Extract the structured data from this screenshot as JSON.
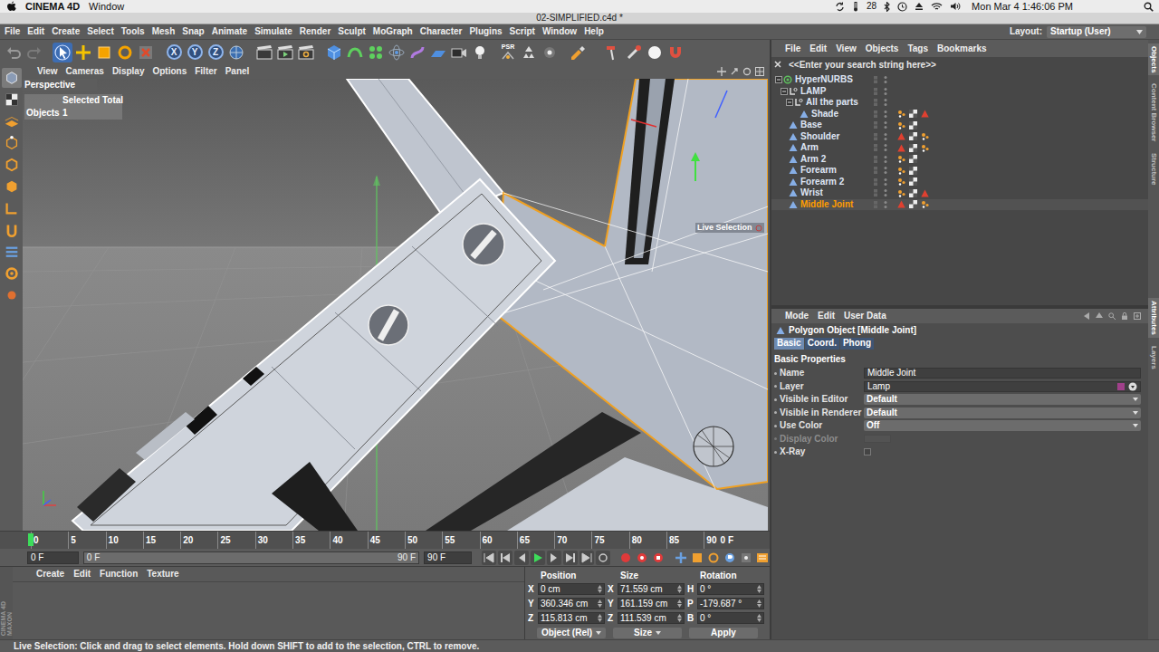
{
  "mac_menubar": {
    "app": "CINEMA 4D",
    "menus": [
      "Window"
    ],
    "indicator": "28",
    "clock": "Mon Mar 4 1:46:06 PM"
  },
  "window": {
    "title": "02-SIMPLIFIED.c4d *"
  },
  "menubar": [
    "File",
    "Edit",
    "Create",
    "Select",
    "Tools",
    "Mesh",
    "Snap",
    "Animate",
    "Simulate",
    "Render",
    "Sculpt",
    "MoGraph",
    "Character",
    "Plugins",
    "Script",
    "Window",
    "Help"
  ],
  "layout": {
    "label": "Layout:",
    "value": "Startup (User)"
  },
  "toolbar": {
    "tools": [
      {
        "selected": true
      },
      {
        "selected": false
      },
      {
        "selected": false
      },
      {
        "selected": false
      },
      {
        "selected": false
      }
    ],
    "axes": [
      {
        "label": "X",
        "on": true
      },
      {
        "label": "Y",
        "on": true
      },
      {
        "label": "Z",
        "on": true
      }
    ],
    "snap_label": "PSR"
  },
  "left_tools": [
    {
      "selected": true
    },
    {
      "selected": false
    },
    {
      "selected": false
    },
    {
      "selected": false
    },
    {
      "selected": false
    },
    {
      "selected": false
    },
    {
      "selected": false
    },
    {
      "selected": false
    },
    {
      "selected": false
    },
    {
      "selected": false
    },
    {
      "selected": false
    }
  ],
  "viewport": {
    "menus": [
      "View",
      "Cameras",
      "Display",
      "Options",
      "Filter",
      "Panel"
    ],
    "camera": "Perspective",
    "stats": {
      "header": "Selected Total",
      "label": "Objects",
      "value": "1"
    },
    "tool_label": "Live Selection"
  },
  "timeline": {
    "ticks": [
      "0",
      "5",
      "10",
      "15",
      "20",
      "25",
      "30",
      "35",
      "40",
      "45",
      "50",
      "55",
      "60",
      "65",
      "70",
      "75",
      "80",
      "85",
      "90"
    ],
    "current_frame": "0 F",
    "level": 0
  },
  "controls": {
    "start": "0 F",
    "range_start": "0 F",
    "range_end": "90 F",
    "end": "90 F"
  },
  "materials": {
    "menus": [
      "Create",
      "Edit",
      "Function",
      "Texture"
    ],
    "logo": [
      "MAXON",
      "CINEMA 4D"
    ]
  },
  "coordinates": {
    "headers": [
      "Position",
      "Size",
      "Rotation"
    ],
    "rows": [
      {
        "axis": "X",
        "position": "0 cm",
        "size_axis": "X",
        "size": "71.559 cm",
        "rotation_axis": "H",
        "rotation": "0 °"
      },
      {
        "axis": "Y",
        "position": "360.346 cm",
        "size_axis": "Y",
        "size": "161.159 cm",
        "rotation_axis": "P",
        "rotation": "-179.687 °"
      },
      {
        "axis": "Z",
        "position": "115.813 cm",
        "size_axis": "Z",
        "size": "111.539 cm",
        "rotation_axis": "B",
        "rotation": "0 °"
      }
    ],
    "mode": "Object (Rel)",
    "size_mode": "Size",
    "apply": "Apply"
  },
  "object_manager": {
    "menus": [
      "File",
      "Edit",
      "View",
      "Objects",
      "Tags",
      "Bookmarks"
    ],
    "search": {
      "placeholder": "<<Enter your search string here>>"
    },
    "objects": [
      {
        "name": "HyperNURBS",
        "kind": "hypernurbs",
        "depth": 0,
        "children": true,
        "expanded": true,
        "selected": false,
        "tags": []
      },
      {
        "name": "LAMP",
        "kind": "null",
        "depth": 1,
        "children": true,
        "expanded": true,
        "selected": false,
        "tags": []
      },
      {
        "name": "All the parts",
        "kind": "null",
        "depth": 2,
        "children": true,
        "expanded": true,
        "selected": false,
        "tags": []
      },
      {
        "name": "Shade",
        "kind": "polygon",
        "depth": 3,
        "children": false,
        "expanded": false,
        "selected": false,
        "tags": [
          {
            "kind": "phong"
          },
          {
            "kind": "material"
          },
          {
            "kind": "alert"
          }
        ]
      },
      {
        "name": "Base",
        "kind": "polygon",
        "depth": 1,
        "children": false,
        "expanded": false,
        "selected": false,
        "tags": [
          {
            "kind": "phong"
          },
          {
            "kind": "material"
          }
        ]
      },
      {
        "name": "Shoulder",
        "kind": "polygon",
        "depth": 1,
        "children": false,
        "expanded": false,
        "selected": false,
        "tags": [
          {
            "kind": "alert"
          },
          {
            "kind": "material"
          },
          {
            "kind": "phong"
          }
        ]
      },
      {
        "name": "Arm",
        "kind": "polygon",
        "depth": 1,
        "children": false,
        "expanded": false,
        "selected": false,
        "tags": [
          {
            "kind": "alert"
          },
          {
            "kind": "material"
          },
          {
            "kind": "phong"
          }
        ]
      },
      {
        "name": "Arm 2",
        "kind": "polygon",
        "depth": 1,
        "children": false,
        "expanded": false,
        "selected": false,
        "tags": [
          {
            "kind": "phong"
          },
          {
            "kind": "material"
          }
        ]
      },
      {
        "name": "Forearm",
        "kind": "polygon",
        "depth": 1,
        "children": false,
        "expanded": false,
        "selected": false,
        "tags": [
          {
            "kind": "phong"
          },
          {
            "kind": "material"
          }
        ]
      },
      {
        "name": "Forearm 2",
        "kind": "polygon",
        "depth": 1,
        "children": false,
        "expanded": false,
        "selected": false,
        "tags": [
          {
            "kind": "phong"
          },
          {
            "kind": "material"
          }
        ]
      },
      {
        "name": "Wrist",
        "kind": "polygon",
        "depth": 1,
        "children": false,
        "expanded": false,
        "selected": false,
        "tags": [
          {
            "kind": "phong"
          },
          {
            "kind": "material"
          },
          {
            "kind": "alert"
          }
        ]
      },
      {
        "name": "Middle Joint",
        "kind": "polygon",
        "depth": 1,
        "children": false,
        "expanded": false,
        "selected": true,
        "tags": [
          {
            "kind": "alert"
          },
          {
            "kind": "material"
          },
          {
            "kind": "phong"
          }
        ]
      }
    ]
  },
  "attributes": {
    "menus": [
      "Mode",
      "Edit",
      "User Data"
    ],
    "title": "Polygon Object [Middle Joint]",
    "tabs": [
      {
        "label": "Basic",
        "selected": true
      },
      {
        "label": "Coord.",
        "selected": false
      },
      {
        "label": "Phong",
        "selected": false
      }
    ],
    "section": "Basic Properties",
    "properties": [
      {
        "label": "Name",
        "kind": "text",
        "value": "Middle Joint",
        "disabled": false
      },
      {
        "label": "Layer",
        "kind": "layer",
        "value": "Lamp",
        "disabled": false
      },
      {
        "label": "Visible in Editor",
        "kind": "dropdown",
        "value": "Default",
        "disabled": false
      },
      {
        "label": "Visible in Renderer",
        "kind": "dropdown",
        "value": "Default",
        "disabled": false
      },
      {
        "label": "Use Color",
        "kind": "dropdown",
        "value": "Off",
        "disabled": false
      },
      {
        "label": "Display Color",
        "kind": "color",
        "disabled": true
      },
      {
        "label": "X-Ray",
        "kind": "checkbox",
        "checked": false,
        "disabled": false
      }
    ]
  },
  "side_tabs": {
    "top": [
      {
        "label": "Objects",
        "selected": true
      },
      {
        "label": "Content Browser",
        "selected": false
      },
      {
        "label": "Structure",
        "selected": false
      }
    ],
    "bottom": [
      {
        "label": "Attributes",
        "selected": true
      },
      {
        "label": "Layers",
        "selected": false
      }
    ]
  },
  "status_bar": "Live Selection: Click and drag to select elements. Hold down SHIFT to add to the selection, CTRL to remove."
}
